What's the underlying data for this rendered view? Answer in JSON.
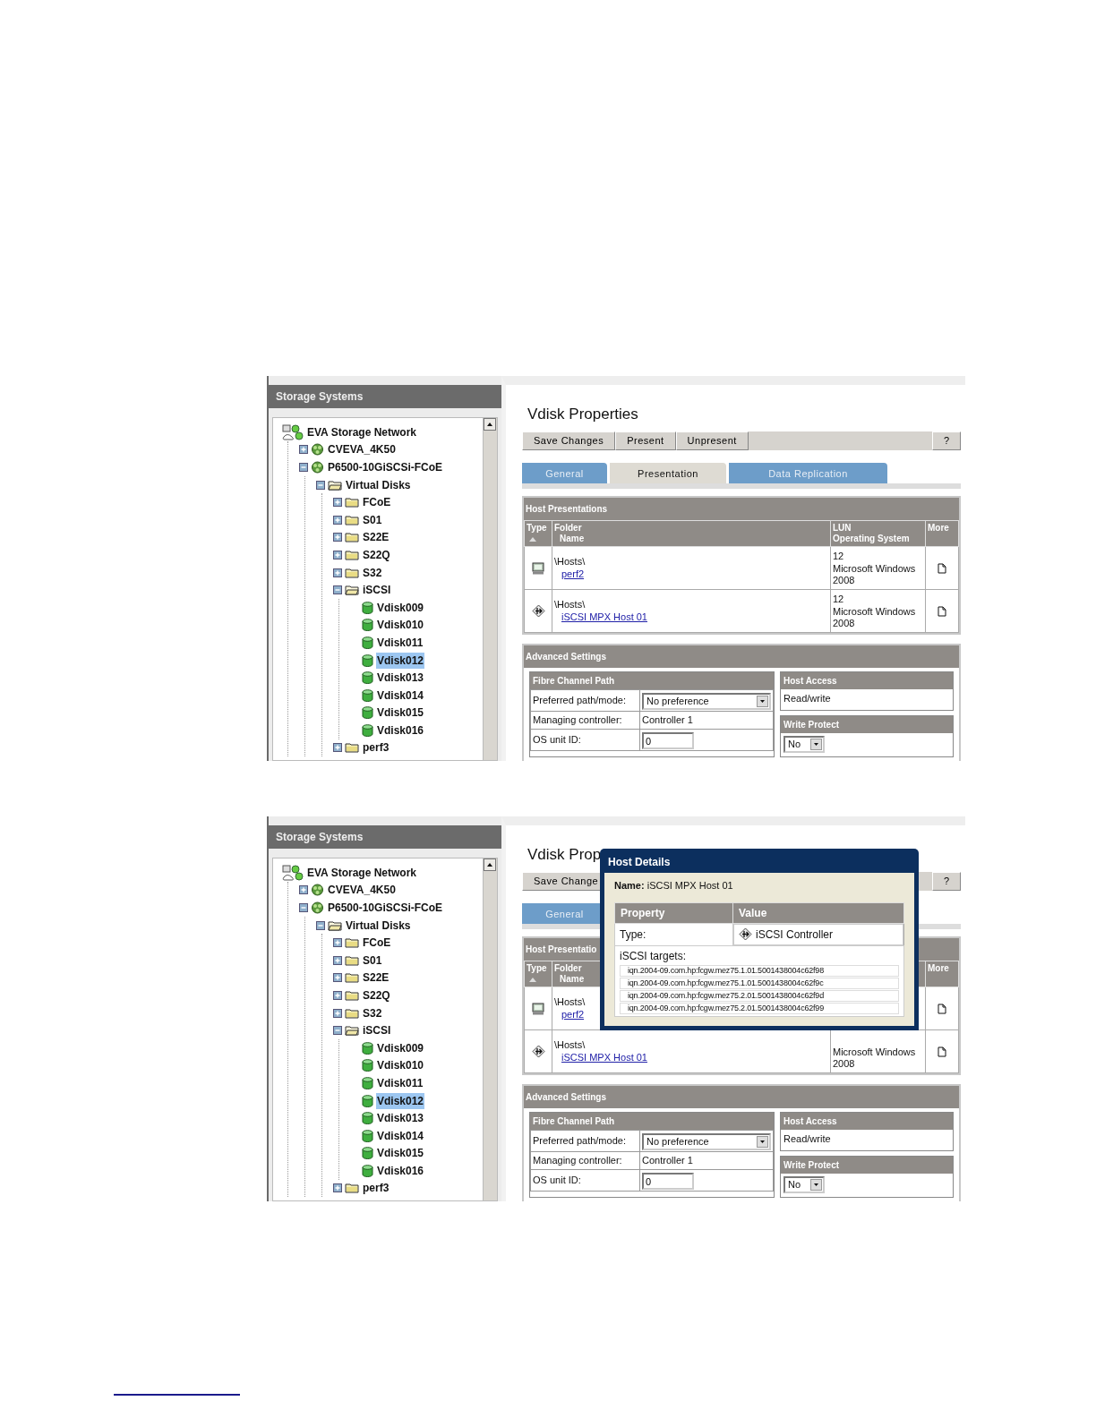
{
  "screens": [
    {
      "sidebar": {
        "title": "Storage Systems",
        "tree": [
          {
            "kind": "network",
            "label": "EVA Storage Network",
            "selected": false,
            "children": [
              {
                "kind": "system",
                "label": "CVEVA_4K50",
                "expanded": false,
                "selected": false
              },
              {
                "kind": "system",
                "label": "P6500-10GiSCSi-FCoE",
                "expanded": true,
                "selected": false,
                "children": [
                  {
                    "kind": "folder",
                    "label": "Virtual Disks",
                    "expanded": true,
                    "selected": false,
                    "children": [
                      {
                        "kind": "folder",
                        "label": "FCoE",
                        "expanded": false,
                        "selected": false
                      },
                      {
                        "kind": "folder",
                        "label": "S01",
                        "expanded": false,
                        "selected": false
                      },
                      {
                        "kind": "folder",
                        "label": "S22E",
                        "expanded": false,
                        "selected": false
                      },
                      {
                        "kind": "folder",
                        "label": "S22Q",
                        "expanded": false,
                        "selected": false
                      },
                      {
                        "kind": "folder",
                        "label": "S32",
                        "expanded": false,
                        "selected": false
                      },
                      {
                        "kind": "folder",
                        "label": "iSCSI",
                        "expanded": true,
                        "selected": false,
                        "children": [
                          {
                            "kind": "vdisk",
                            "label": "Vdisk009",
                            "selected": false
                          },
                          {
                            "kind": "vdisk",
                            "label": "Vdisk010",
                            "selected": false
                          },
                          {
                            "kind": "vdisk",
                            "label": "Vdisk011",
                            "selected": false
                          },
                          {
                            "kind": "vdisk",
                            "label": "Vdisk012",
                            "selected": true
                          },
                          {
                            "kind": "vdisk",
                            "label": "Vdisk013",
                            "selected": false
                          },
                          {
                            "kind": "vdisk",
                            "label": "Vdisk014",
                            "selected": false
                          },
                          {
                            "kind": "vdisk",
                            "label": "Vdisk015",
                            "selected": false
                          },
                          {
                            "kind": "vdisk",
                            "label": "Vdisk016",
                            "selected": false
                          }
                        ]
                      },
                      {
                        "kind": "folder",
                        "label": "perf3",
                        "expanded": false,
                        "selected": false
                      }
                    ]
                  }
                ]
              }
            ]
          }
        ]
      },
      "title": "Vdisk Properties",
      "toolbar": [
        "Save Changes",
        "Present",
        "Unpresent"
      ],
      "help": "?",
      "tabs": [
        {
          "label": "General",
          "selected": false
        },
        {
          "label": "Presentation",
          "selected": true
        },
        {
          "label": "Data Replication",
          "selected": false
        }
      ],
      "presentations": {
        "title": "Host Presentations",
        "columns": [
          {
            "kind": "type",
            "lines": [
              "Type"
            ],
            "sorted": true
          },
          {
            "kind": "folder",
            "lines": [
              "Folder",
              "Name"
            ]
          },
          {
            "kind": "lun",
            "lines": [
              "LUN",
              "Operating System"
            ]
          },
          {
            "kind": "more",
            "lines": [
              "More"
            ]
          }
        ],
        "rows": [
          {
            "kind": "host",
            "folder": "\\Hosts\\",
            "name": "perf2",
            "lun": [
              "12",
              "Microsoft Windows",
              "2008"
            ]
          },
          {
            "kind": "iscsi",
            "folder": "\\Hosts\\",
            "name": "iSCSI MPX Host 01",
            "lun": [
              "12",
              "Microsoft Windows",
              "2008"
            ]
          }
        ]
      },
      "advanced": {
        "title": "Advanced Settings",
        "path_title": "Fibre Channel Path",
        "preferred_label": "Preferred path/mode:",
        "preferred_value": "No preference",
        "controller_label": "Managing controller:",
        "controller_value": "Controller 1",
        "unit_label": "OS unit ID:",
        "unit_value": "0",
        "access_title": "Host Access",
        "access_value": "Read/write",
        "protect_title": "Write Protect",
        "protect_value": "No"
      }
    },
    {
      "sidebar": {
        "title": "Storage Systems",
        "tree": [
          {
            "kind": "network",
            "label": "EVA Storage Network",
            "selected": false,
            "children": [
              {
                "kind": "system",
                "label": "CVEVA_4K50",
                "expanded": false,
                "selected": false
              },
              {
                "kind": "system",
                "label": "P6500-10GiSCSi-FCoE",
                "expanded": true,
                "selected": false,
                "children": [
                  {
                    "kind": "folder",
                    "label": "Virtual Disks",
                    "expanded": true,
                    "selected": false,
                    "children": [
                      {
                        "kind": "folder",
                        "label": "FCoE",
                        "expanded": false,
                        "selected": false
                      },
                      {
                        "kind": "folder",
                        "label": "S01",
                        "expanded": false,
                        "selected": false
                      },
                      {
                        "kind": "folder",
                        "label": "S22E",
                        "expanded": false,
                        "selected": false
                      },
                      {
                        "kind": "folder",
                        "label": "S22Q",
                        "expanded": false,
                        "selected": false
                      },
                      {
                        "kind": "folder",
                        "label": "S32",
                        "expanded": false,
                        "selected": false
                      },
                      {
                        "kind": "folder",
                        "label": "iSCSI",
                        "expanded": true,
                        "selected": false,
                        "children": [
                          {
                            "kind": "vdisk",
                            "label": "Vdisk009",
                            "selected": false
                          },
                          {
                            "kind": "vdisk",
                            "label": "Vdisk010",
                            "selected": false
                          },
                          {
                            "kind": "vdisk",
                            "label": "Vdisk011",
                            "selected": false
                          },
                          {
                            "kind": "vdisk",
                            "label": "Vdisk012",
                            "selected": true
                          },
                          {
                            "kind": "vdisk",
                            "label": "Vdisk013",
                            "selected": false
                          },
                          {
                            "kind": "vdisk",
                            "label": "Vdisk014",
                            "selected": false
                          },
                          {
                            "kind": "vdisk",
                            "label": "Vdisk015",
                            "selected": false
                          },
                          {
                            "kind": "vdisk",
                            "label": "Vdisk016",
                            "selected": false
                          }
                        ]
                      },
                      {
                        "kind": "folder",
                        "label": "perf3",
                        "expanded": false,
                        "selected": false
                      }
                    ]
                  }
                ]
              }
            ]
          }
        ]
      },
      "title": "Vdisk Prop",
      "toolbar": [
        "Save Change"
      ],
      "help": "?",
      "tabs": [
        {
          "label": "General",
          "selected": false
        }
      ],
      "presentations": {
        "title": "Host Presentatio",
        "columns": [
          {
            "kind": "type",
            "lines": [
              "Type"
            ],
            "sorted": true
          },
          {
            "kind": "folder",
            "lines": [
              "Folder",
              "Name"
            ]
          },
          {
            "kind": "more",
            "lines": [
              "More"
            ]
          }
        ],
        "rows": [
          {
            "kind": "host",
            "folder": "\\Hosts\\",
            "name": "perf2"
          },
          {
            "kind": "iscsi",
            "folder": "\\Hosts\\",
            "name": "iSCSI MPX Host 01",
            "lun": [
              "Microsoft Windows",
              "2008"
            ]
          }
        ]
      },
      "advanced": {
        "title": "Advanced Settings",
        "path_title": "Fibre Channel Path",
        "preferred_label": "Preferred path/mode:",
        "preferred_value": "No preference",
        "controller_label": "Managing controller:",
        "controller_value": "Controller 1",
        "unit_label": "OS unit ID:",
        "unit_value": "0",
        "access_title": "Host Access",
        "access_value": "Read/write",
        "protect_title": "Write Protect",
        "protect_value": "No"
      },
      "dialog": {
        "title": "Host Details",
        "name": "**Name:** iSCSI MPX Host 01",
        "columns": [
          "Property",
          "Value"
        ],
        "rows": [
          {
            "kind": "iscsi",
            "property": "Type:",
            "value": "iSCSI Controller"
          }
        ],
        "targets_label": "iSCSI targets:",
        "targets": [
          "iqn.2004-09.com.hp:fcgw.mez75.1.01.5001438004c62f98",
          "iqn.2004-09.com.hp:fcgw.mez75.1.01.5001438004c62f9c",
          "iqn.2004-09.com.hp:fcgw.mez75.2.01.5001438004c62f9d",
          "iqn.2004-09.com.hp:fcgw.mez75.2.01.5001438004c62f99"
        ]
      }
    }
  ]
}
